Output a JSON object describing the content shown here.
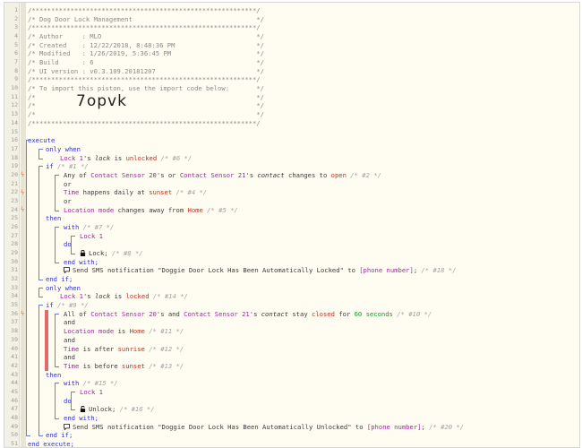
{
  "header_lines": [
    "/**********************************************************/",
    "/* Dog Door Lock Management                                */",
    "/**********************************************************/",
    "/* Author     : MLO                                        */",
    "/* Created    : 12/22/2018, 8:48:36 PM                     */",
    "/* Modified   : 1/26/2019, 5:36:45 PM                      */",
    "/* Build      : 6                                          */",
    "/* UI version : v0.3.109.20181207                          */",
    "/**********************************************************/",
    "/* To import this piston, use the import code below:       */",
    "/*                                                         */",
    "/*                                                         */",
    "/*                                                         */",
    "/**********************************************************/"
  ],
  "import_code": "7opvk",
  "line_numbers": [
    "1",
    "2",
    "3",
    "4",
    "5",
    "6",
    "7",
    "8",
    "9",
    "10",
    "11",
    "12",
    "13",
    "14",
    "15",
    "16",
    "17",
    "18",
    "19",
    "20",
    "21",
    "22",
    "23",
    "24",
    "25",
    "26",
    "27",
    "28",
    "29",
    "30",
    "31",
    "32",
    "33",
    "34",
    "35",
    "36",
    "37",
    "38",
    "39",
    "40",
    "41",
    "42",
    "43",
    "44",
    "45",
    "46",
    "47",
    "48",
    "49",
    "50",
    "51"
  ],
  "code": {
    "execute": "execute",
    "only_when": "only when",
    "lock1": "Lock 1",
    "s_lock": "'s",
    "lock_attr": "lock",
    "is": "is",
    "unlocked": "unlocked",
    "c6": "/* #6 */",
    "if": "if",
    "c1": "/* #1 */",
    "any_of": "Any of",
    "cs20": "Contact Sensor 20",
    "s_or": "'s or",
    "cs21": "Contact Sensor 21",
    "s": "'s",
    "contact": "contact",
    "changes_to": "changes to",
    "open": "open",
    "c2": "/* #2 */",
    "or": "or",
    "time": "Time",
    "happens_daily": "happens daily at",
    "sunset": "sunset",
    "c4": "/* #4 */",
    "loc_mode": "Location mode",
    "changes_away": "changes away from",
    "home": "Home",
    "c5": "/* #5 */",
    "then": "then",
    "with": "with",
    "c7": "/* #7 */",
    "do": "do",
    "lock_cmd": "Lock;",
    "c8": "/* #8 */",
    "end_with": "end with;",
    "send_sms": "Send SMS notification",
    "msg1": "\"Doggie Door Lock Has Been Automatically Locked\"",
    "to": "to",
    "phone": "[phone number]",
    "c18": "/* #18 */",
    "end_if": "end if;",
    "locked": "locked",
    "c14": "/* #14 */",
    "c9": "/* #9 */",
    "all_of": "All of",
    "and_w": "'s and",
    "stay": "stay",
    "closed": "closed",
    "for": "for",
    "sixty": "60 seconds",
    "c10": "/* #10 */",
    "and": "and",
    "c11": "/* #11 */",
    "is_after": "is after",
    "sunrise": "sunrise",
    "c12": "/* #12 */",
    "is_before": "is before",
    "c13": "/* #13 */",
    "c15": "/* #15 */",
    "unlock_cmd": "Unlock;",
    "c16": "/* #16 */",
    "msg2": "\"Doggie Door Lock Has Been Automatically Unlocked\"",
    "c20": "/* #20 */",
    "end_execute": "end execute;"
  },
  "colors": {
    "keyword": "#3030d0",
    "device": "#9b2c9b",
    "value": "#c03020",
    "number": "#209030",
    "bracket": "#6b7fd9",
    "marker": "#e07b39",
    "condition_bar": "#e36a6a"
  },
  "icons": [
    "lightning-icon",
    "lock-icon",
    "unlock-icon",
    "sms-icon"
  ]
}
